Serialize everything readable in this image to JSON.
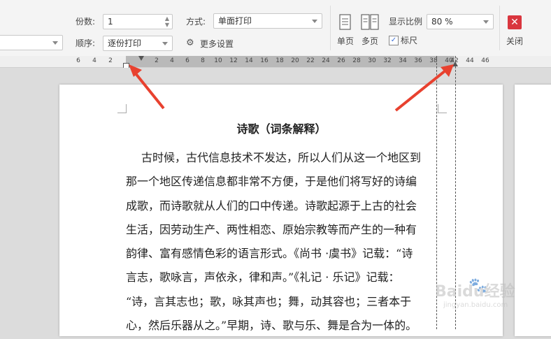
{
  "toolbar": {
    "copies_label": "份数:",
    "copies_value": "1",
    "mode_label": "方式:",
    "mode_value": "单面打印",
    "order_label": "顺序:",
    "order_value": "逐份打印",
    "more_settings": "更多设置",
    "single_page": "单页",
    "multi_page": "多页",
    "zoom_label": "显示比例",
    "zoom_value": "80 %",
    "ruler_checkbox": "标尺",
    "close_label": "关闭"
  },
  "ruler": {
    "ticks": [
      "6",
      "4",
      "2",
      "2",
      "4",
      "6",
      "8",
      "10",
      "12",
      "14",
      "16",
      "18",
      "20",
      "22",
      "24",
      "26",
      "28",
      "30",
      "32",
      "34",
      "36",
      "38",
      "40",
      "42",
      "44",
      "46"
    ]
  },
  "document": {
    "title": "诗歌（词条解释）",
    "lines": [
      "古时候，古代信息技术不发达，所以人们从这一个地区到",
      "那一个地区传递信息都非常不方便，于是他们将写好的诗编",
      "成歌，而诗歌就从人们的口中传递。诗歌起源于上古的社会",
      "生活，因劳动生产、两性相恋、原始宗教等而产生的一种有",
      "韵律、富有感情色彩的语言形式。《尚书 ·虞书》记载：“诗",
      "言志，歌咏言，声依永，律和声。”《礼记 · 乐记》记载：",
      "“诗，言其志也；歌，咏其声也；舞，动其容也；三者本于",
      "心，然后乐器从之。”早期，诗、歌与乐、舞是合为一体的。"
    ]
  },
  "watermark": {
    "brand": "Baidu经验",
    "url": "jingyan.baidu.com"
  },
  "colors": {
    "annotation_arrow": "#e8412f",
    "close_button": "#d9363e"
  }
}
